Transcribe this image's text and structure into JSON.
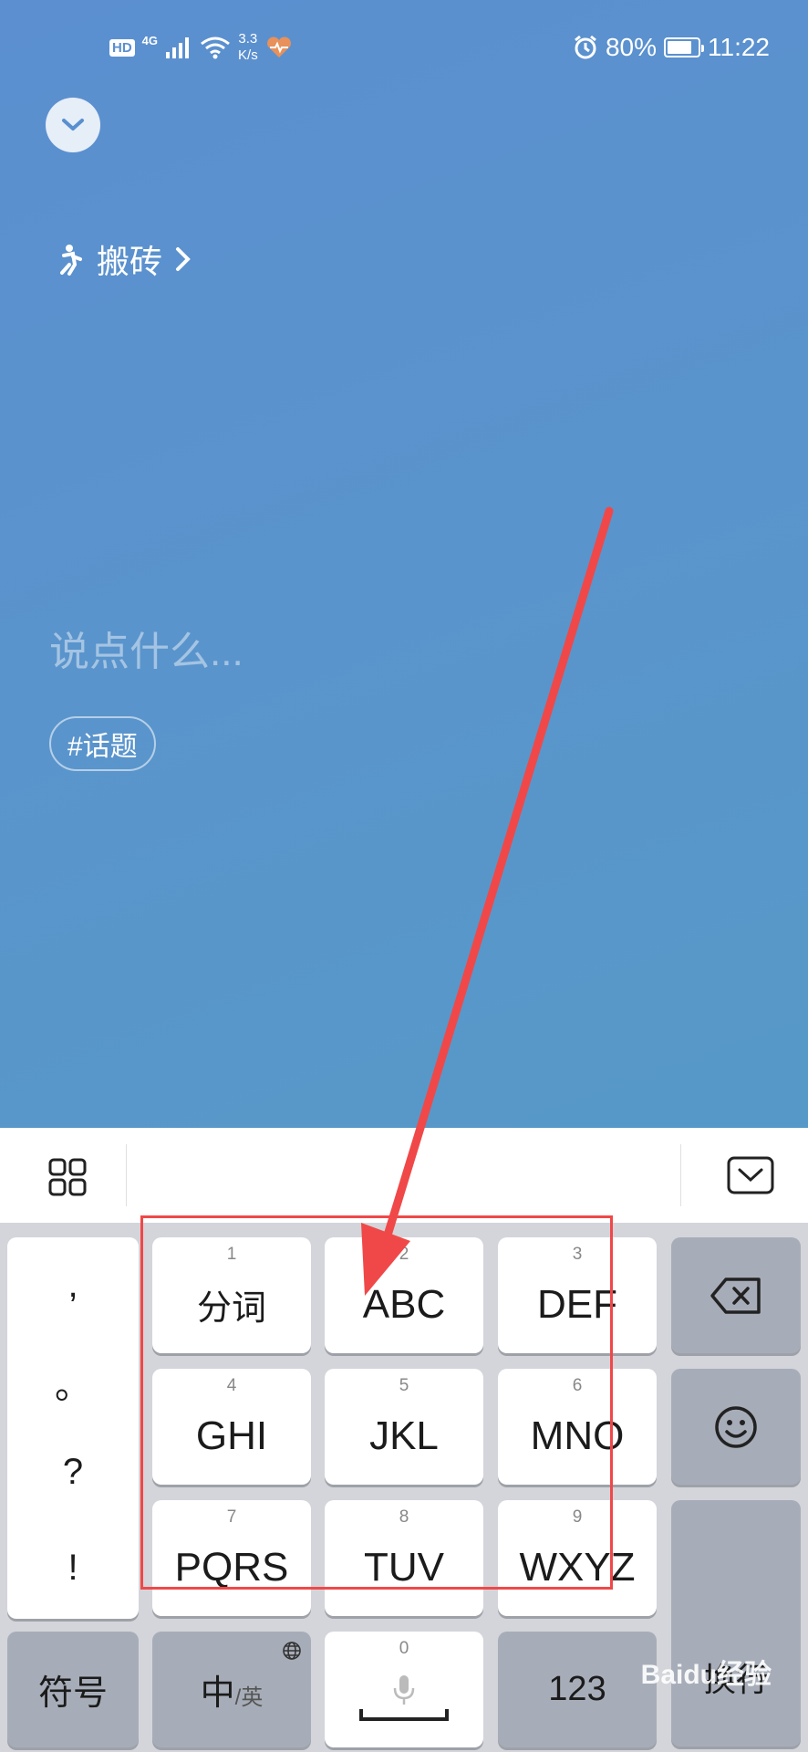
{
  "status_bar": {
    "hd": "HD",
    "network": "4G",
    "speed_value": "3.3",
    "speed_unit": "K/s",
    "battery": "80%",
    "battery_level": 0.8,
    "time": "11:22"
  },
  "composer": {
    "category": "搬砖",
    "placeholder": "说点什么...",
    "topic_chip": "#话题"
  },
  "keyboard": {
    "punctuation": [
      ",",
      "。",
      "?",
      "!"
    ],
    "keys": [
      {
        "num": "1",
        "label": "分词"
      },
      {
        "num": "2",
        "label": "ABC"
      },
      {
        "num": "3",
        "label": "DEF"
      },
      {
        "num": "4",
        "label": "GHI"
      },
      {
        "num": "5",
        "label": "JKL"
      },
      {
        "num": "6",
        "label": "MNO"
      },
      {
        "num": "7",
        "label": "PQRS"
      },
      {
        "num": "8",
        "label": "TUV"
      },
      {
        "num": "9",
        "label": "WXYZ"
      }
    ],
    "enter": "换行",
    "symbols": "符号",
    "lang_main": "中",
    "lang_sub": "/英",
    "space_num": "0",
    "numbers": "123"
  },
  "watermark": "Baidu经验",
  "colors": {
    "app_bg": "#5a94cc",
    "annotation": "#f04848"
  }
}
